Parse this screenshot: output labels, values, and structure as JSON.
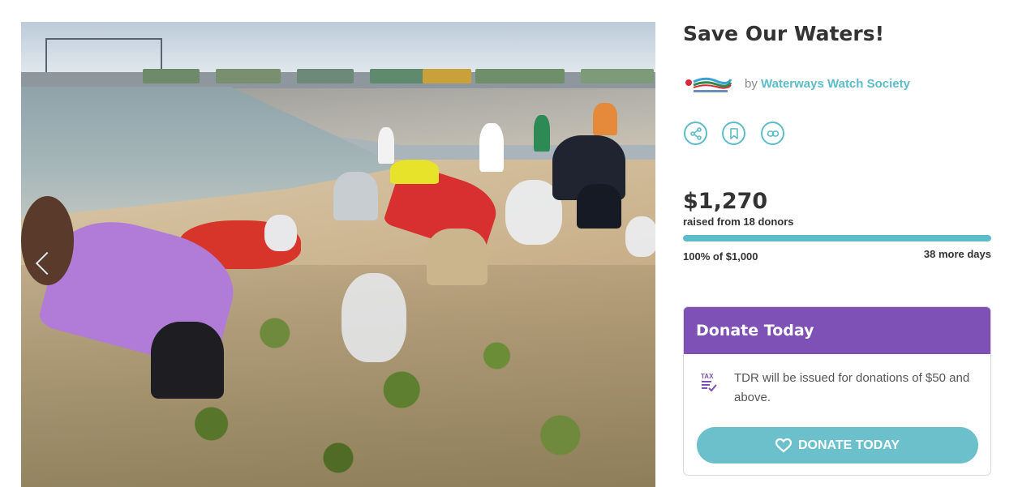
{
  "campaign": {
    "title": "Save Our Waters!",
    "by_prefix": "by",
    "organizer": "Waterways Watch Society"
  },
  "hero": {
    "image_alt": "Volunteers picking up litter on a beach",
    "prev_icon": "chevron-left-icon"
  },
  "actions": [
    {
      "name": "share",
      "icon": "share-icon"
    },
    {
      "name": "bookmark",
      "icon": "bookmark-icon"
    },
    {
      "name": "link",
      "icon": "link-icon"
    }
  ],
  "funding": {
    "amount": "$1,270",
    "raised_text": "raised from 18 donors",
    "goal_text": "100% of $1,000",
    "days_left": "38 more days",
    "progress_fraction": 1.0
  },
  "donate": {
    "header": "Donate Today",
    "tax_icon": "tax-icon",
    "tax_note": "TDR will be issued for donations of $50 and above.",
    "button_label": "DONATE TODAY",
    "button_icon": "heart-icon"
  },
  "colors": {
    "accent": "#5dbcc9",
    "donate_header": "#7d51b5",
    "button": "#6cc0cc"
  }
}
